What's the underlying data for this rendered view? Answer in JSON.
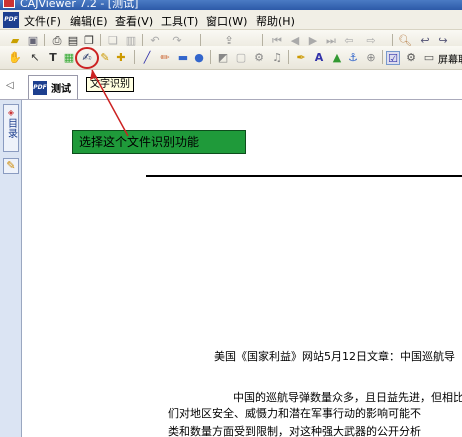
{
  "window": {
    "title": "CAJViewer 7.2 - [测试]"
  },
  "menu": {
    "items": [
      "文件(F)",
      "编辑(E)",
      "查看(V)",
      "工具(T)",
      "窗口(W)",
      "帮助(H)"
    ]
  },
  "toolbar2": {
    "screenshot_label": "屏幕取"
  },
  "tabs": {
    "active_label": "测试"
  },
  "tooltip": {
    "text": "文字识别"
  },
  "sidebar": {
    "bookmark_label": "目录"
  },
  "annotation": {
    "callout_text": "选择这个文件识别功能",
    "highlight_color": "#cc2222",
    "callout_color": "#1f9a3a"
  },
  "document": {
    "headline": "美国《国家利益》网站5月12日文章：中国巡航导",
    "para_line1": "中国的巡航导弹数量众多，且日益先进，但相比",
    "para_line2": "们对地区安全、威慑力和潜在军事行动的影响可能不",
    "para_line3": "类和数量方面受到限制，对这种强大武器的公开分析"
  }
}
